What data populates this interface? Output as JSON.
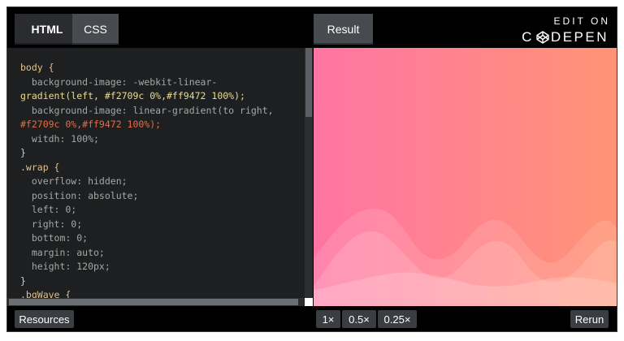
{
  "header": {
    "tabs": {
      "html": "HTML",
      "css": "CSS",
      "result": "Result"
    },
    "brand": {
      "top": "EDIT ON",
      "bottom_pre": "C",
      "bottom_post": "DEPEN"
    }
  },
  "code": {
    "lines": [
      "body {",
      "  background-image: -webkit-linear-",
      "gradient(left, #f2709c 0%,#ff9472 100%);",
      "  background-image: linear-gradient(to right,",
      "#f2709c 0%,#ff9472 100%);",
      "  witdh: 100%;",
      "}",
      ".wrap {",
      "  overflow: hidden;",
      "  position: absolute;",
      "  left: 0;",
      "  right: 0;",
      "  bottom: 0;",
      "  margin: auto;",
      "  height: 120px;",
      "}",
      ".bgWave {"
    ]
  },
  "footer": {
    "resources": "Resources",
    "zoom_1x": "1×",
    "zoom_05x": "0.5×",
    "zoom_025x": "0.25×",
    "rerun": "Rerun"
  },
  "colors": {
    "gradient_start": "#f2709c",
    "gradient_end": "#ff9472"
  },
  "icons": {
    "brand_logo": "codepen-cube-icon"
  }
}
